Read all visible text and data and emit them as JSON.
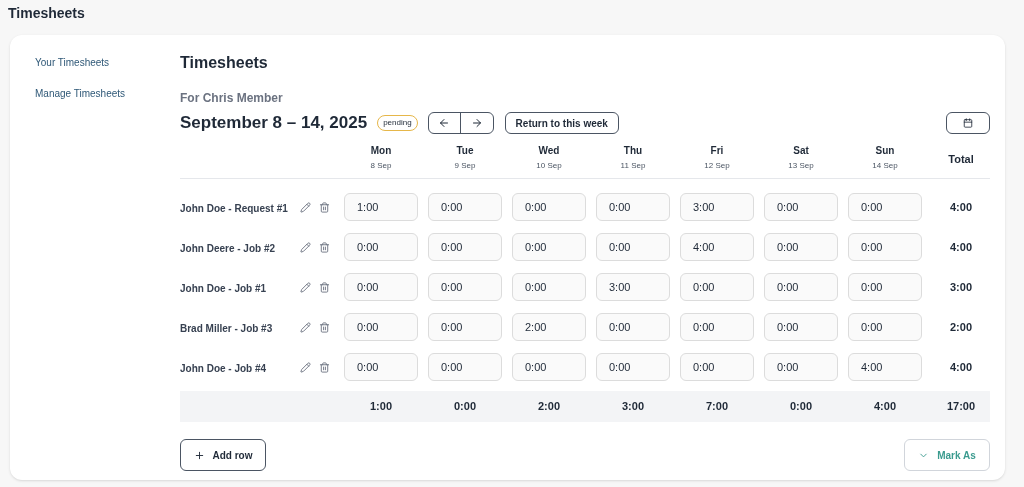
{
  "page_title": "Timesheets",
  "sidebar": {
    "items": [
      {
        "label": "Your Timesheets"
      },
      {
        "label": "Manage Timesheets"
      }
    ]
  },
  "heading": "Timesheets",
  "subtitle": "For Chris Member",
  "week": {
    "range": "September 8 – 14, 2025",
    "status": "pending",
    "return_button": "Return to this week"
  },
  "table": {
    "days": [
      {
        "day": "Mon",
        "date": "8 Sep"
      },
      {
        "day": "Tue",
        "date": "9 Sep"
      },
      {
        "day": "Wed",
        "date": "10 Sep"
      },
      {
        "day": "Thu",
        "date": "11 Sep"
      },
      {
        "day": "Fri",
        "date": "12 Sep"
      },
      {
        "day": "Sat",
        "date": "13 Sep"
      },
      {
        "day": "Sun",
        "date": "14 Sep"
      }
    ],
    "total_header": "Total",
    "rows": [
      {
        "name": "John Doe - Request #1",
        "values": [
          "1:00",
          "0:00",
          "0:00",
          "0:00",
          "3:00",
          "0:00",
          "0:00"
        ],
        "total": "4:00"
      },
      {
        "name": "John Deere - Job #2",
        "values": [
          "0:00",
          "0:00",
          "0:00",
          "0:00",
          "4:00",
          "0:00",
          "0:00"
        ],
        "total": "4:00"
      },
      {
        "name": "John Doe - Job #1",
        "values": [
          "0:00",
          "0:00",
          "0:00",
          "3:00",
          "0:00",
          "0:00",
          "0:00"
        ],
        "total": "3:00"
      },
      {
        "name": "Brad Miller - Job #3",
        "values": [
          "0:00",
          "0:00",
          "2:00",
          "0:00",
          "0:00",
          "0:00",
          "0:00"
        ],
        "total": "2:00"
      },
      {
        "name": "John Doe - Job #4",
        "values": [
          "0:00",
          "0:00",
          "0:00",
          "0:00",
          "0:00",
          "0:00",
          "4:00"
        ],
        "total": "4:00"
      }
    ],
    "day_totals": [
      "1:00",
      "0:00",
      "2:00",
      "3:00",
      "7:00",
      "0:00",
      "4:00"
    ],
    "grand_total": "17:00"
  },
  "add_row_button": "Add row",
  "mark_as_button": "Mark As"
}
